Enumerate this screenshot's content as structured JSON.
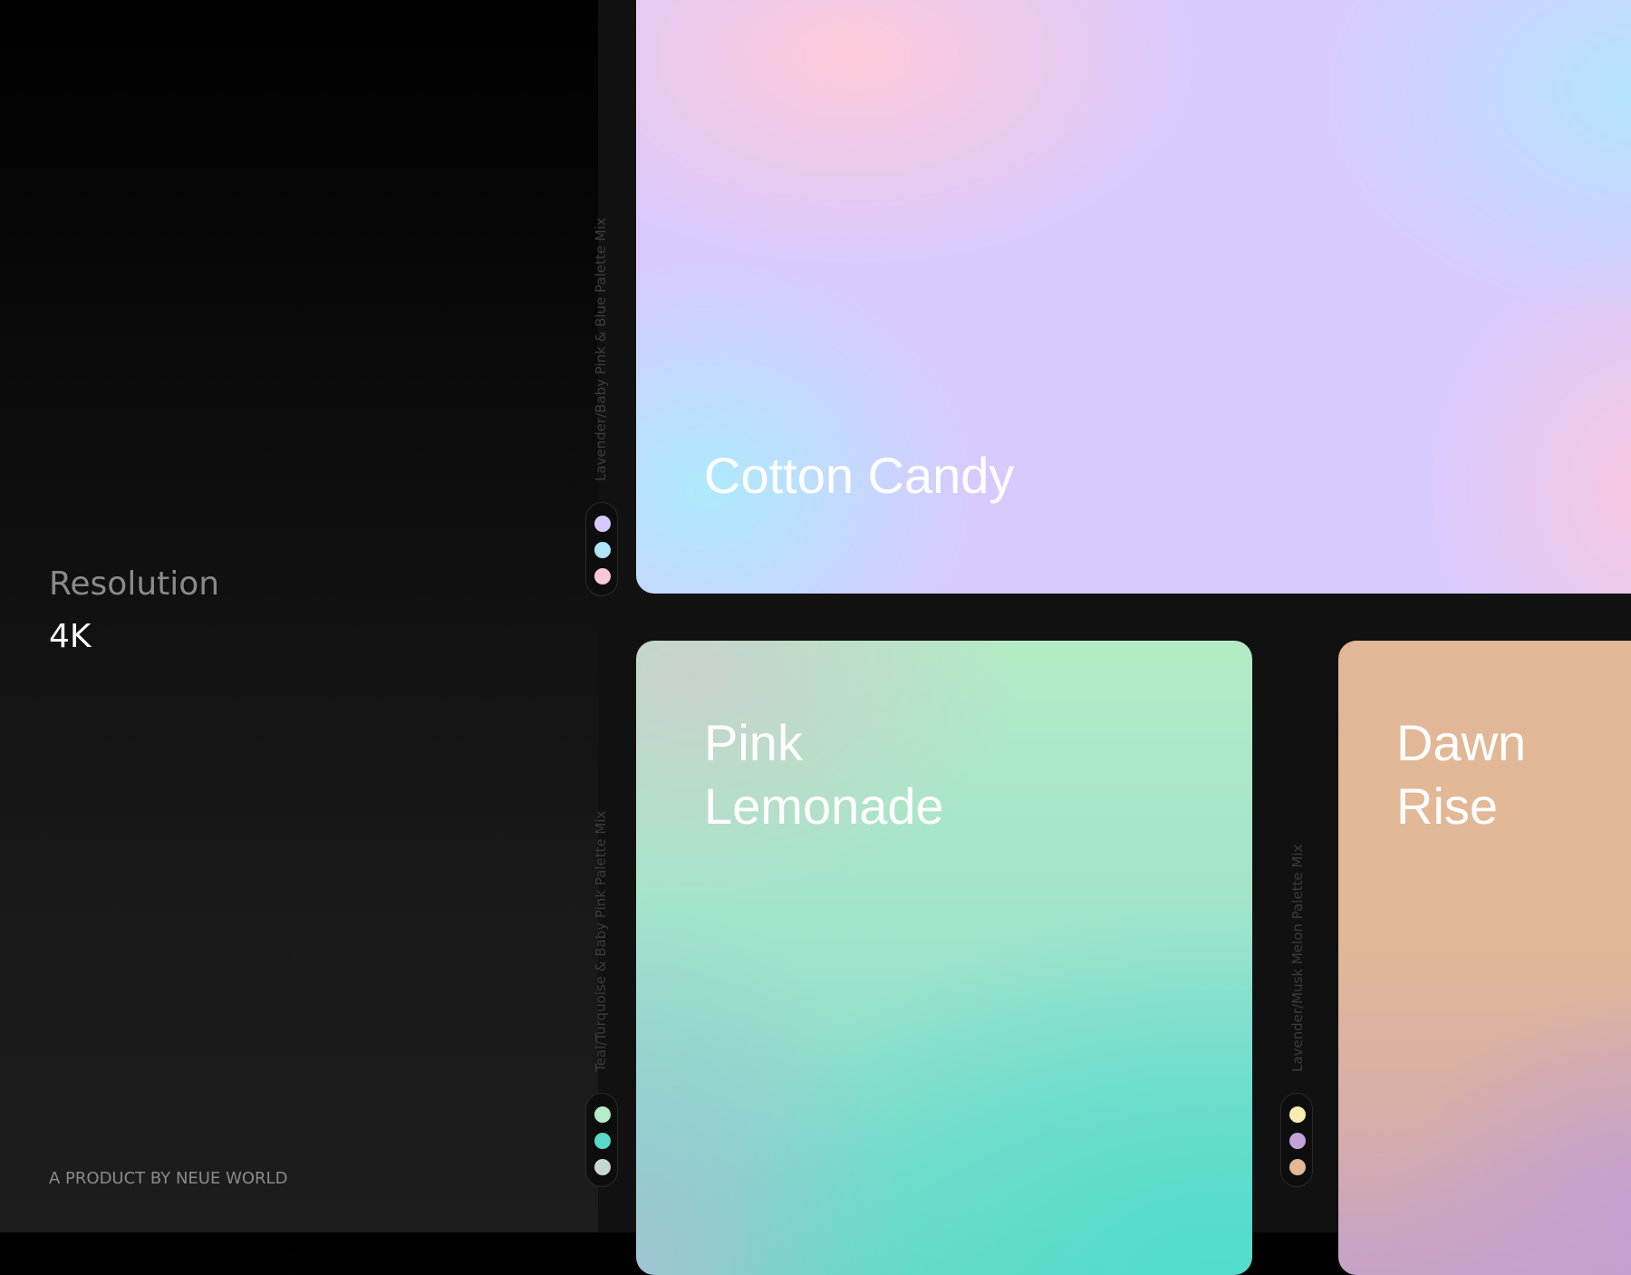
{
  "sidebar": {
    "resolution_label": "Resolution",
    "resolution_value": "4K",
    "credit": "A PRODUCT BY NEUE WORLD"
  },
  "cards": [
    {
      "title": "Cotton Candy",
      "palette": "Lavender/Baby Pink & Blue Palette Mix",
      "swatches": [
        "#d8c8fb",
        "#afe5fb",
        "#fbc8d6"
      ]
    },
    {
      "title": "Pink\nLemonade",
      "palette": "Teal/Turquoise & Baby Pink Palette Mix",
      "swatches": [
        "#b4ebc8",
        "#5ad8c8",
        "#c8d8d0"
      ]
    },
    {
      "title": "Dawn\nRise",
      "palette": "Lavender/Musk Melon  Palette Mix",
      "swatches": [
        "#f8ecb0",
        "#c4a2d8",
        "#e2b896"
      ]
    }
  ]
}
